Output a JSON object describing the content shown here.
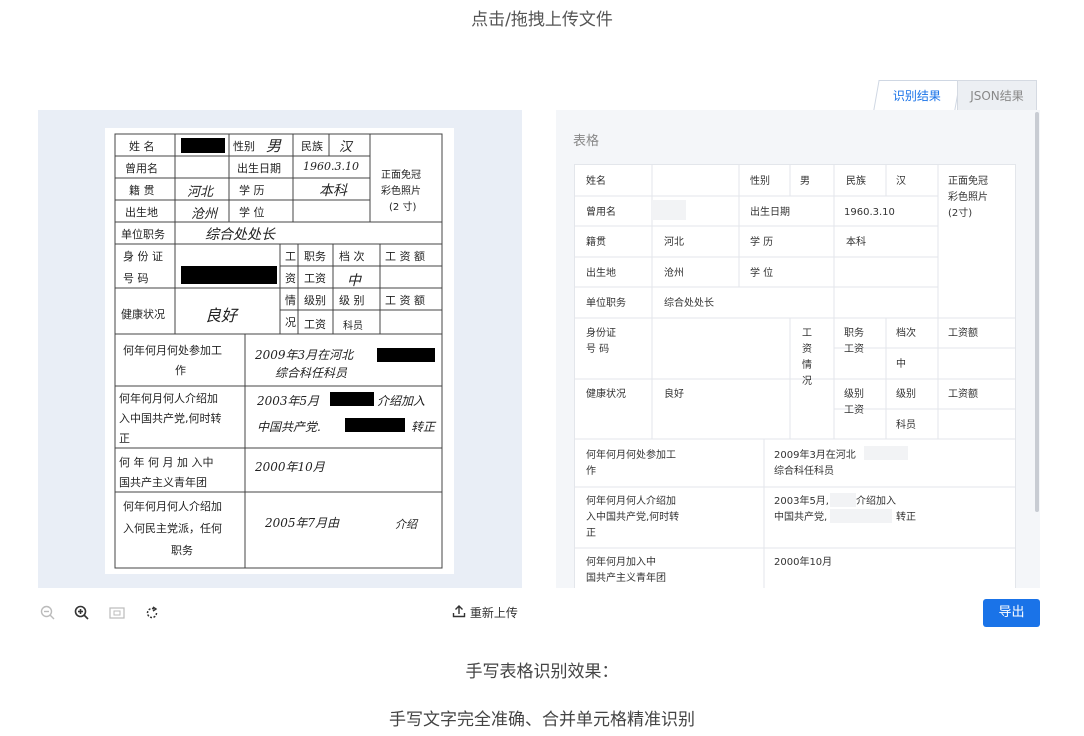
{
  "upload": {
    "title": "点击/拖拽上传文件"
  },
  "tabs": [
    {
      "label": "识别结果"
    },
    {
      "label": "JSON结果"
    }
  ],
  "result": {
    "section_label": "表格"
  },
  "toolbar": {
    "reupload_label": "重新上传",
    "export_label": "导出"
  },
  "captions": {
    "line1": "手写表格识别效果：",
    "line2": "手写文字完全准确、合并单元格精准识别"
  },
  "paper": {
    "name_label": "姓 名",
    "gender_label": "性别",
    "gender_value": "男",
    "ethnic_label": "民族",
    "ethnic_value": "汉",
    "photo_l1": "正面免冠",
    "photo_l2": "彩色照片",
    "photo_l3": "(2 寸)",
    "former_label": "曾用名",
    "birth_label": "出生日期",
    "birth_value": "1960.3.10",
    "native_label": "籍 贯",
    "native_value": "河北",
    "edu_label": "学   历",
    "edu_value": "本科",
    "birthplace_label": "出生地",
    "birthplace_value": "沧州",
    "degree_label": "学   位",
    "job_label": "单位职务",
    "job_value": "综合处处长",
    "id_l1": "身 份 证",
    "id_l2": "号   码",
    "w1": "工",
    "w2": "资",
    "w3": "情",
    "w4": "况",
    "duty_label": "职务",
    "grade_label": "档 次",
    "wage_label": "工 资 额",
    "wage_l": "工资",
    "wage_mid": "中",
    "level_label": "级别",
    "level_grade": "级 别",
    "wage_label2": "工 资 额",
    "wage_l2": "工资",
    "wage_level": "科员",
    "health_label": "健康状况",
    "health_value": "良好",
    "q1_l1": "何年何月何处参加工",
    "q1_l2": "作",
    "a1_l1": "2009年3月在河北",
    "a1_l2": "综合科任科员",
    "q2_l1": "何年何月何人介绍加",
    "q2_l2": "入中国共产党,何时转",
    "q2_l3": "正",
    "a2_l1": "2003年5月",
    "a2_l1b": "介绍加入",
    "a2_l2": "中国共产党.",
    "a2_l2b": "转正",
    "q3_l1": "何 年 何 月 加 入中",
    "q3_l2": "国共产主义青年团",
    "a3": "2000年10月",
    "q4_l1": "何年何月何人介绍加",
    "q4_l2": "入何民主党派，任何",
    "q4_l3": "职务",
    "a4": "2005年7月由",
    "a4b": "介绍"
  },
  "table": {
    "name": "姓名",
    "gender": "性别",
    "gender_v": "男",
    "ethnic": "民族",
    "ethnic_v": "汉",
    "photo_l1": "正面免冠",
    "photo_l2": "彩色照片",
    "photo_l3": "(2寸)",
    "former": "曾用名",
    "birth": "出生日期",
    "birth_v": "1960.3.10",
    "native": "籍贯",
    "native_v": "河北",
    "edu": "学 历",
    "edu_v": "本科",
    "birthplace": "出生地",
    "birthplace_v": "沧州",
    "degree": "学 位",
    "job": "单位职务",
    "job_v": "综合处处长",
    "id_l1": "身份证",
    "id_l2": "号 码",
    "w1": "工",
    "w2": "资",
    "w3": "情",
    "w4": "况",
    "duty_l1": "职务",
    "duty_l2": "工资",
    "grade": "档次",
    "wage": "工资额",
    "mid": "中",
    "level_l1": "级别",
    "level_l2": "工资",
    "level_grade": "级别",
    "wage2": "工资额",
    "clerk": "科员",
    "health": "健康状况",
    "health_v": "良好",
    "q1_l1": "何年何月何处参加工",
    "q1_l2": "作",
    "a1_l1": "2009年3月在河北",
    "a1_l2": "综合科任科员",
    "q2_l1": "何年何月何人介绍加",
    "q2_l2": "入中国共产党,何时转",
    "q2_l3": "正",
    "a2_l1": "2003年5月,",
    "a2_l1b": "介绍加入",
    "a2_l2": "中国共产党,",
    "a2_l2b": "转正",
    "q3_l1": "何年何月加入中",
    "q3_l2": "国共产主义青年团",
    "a3": "2000年10月"
  }
}
